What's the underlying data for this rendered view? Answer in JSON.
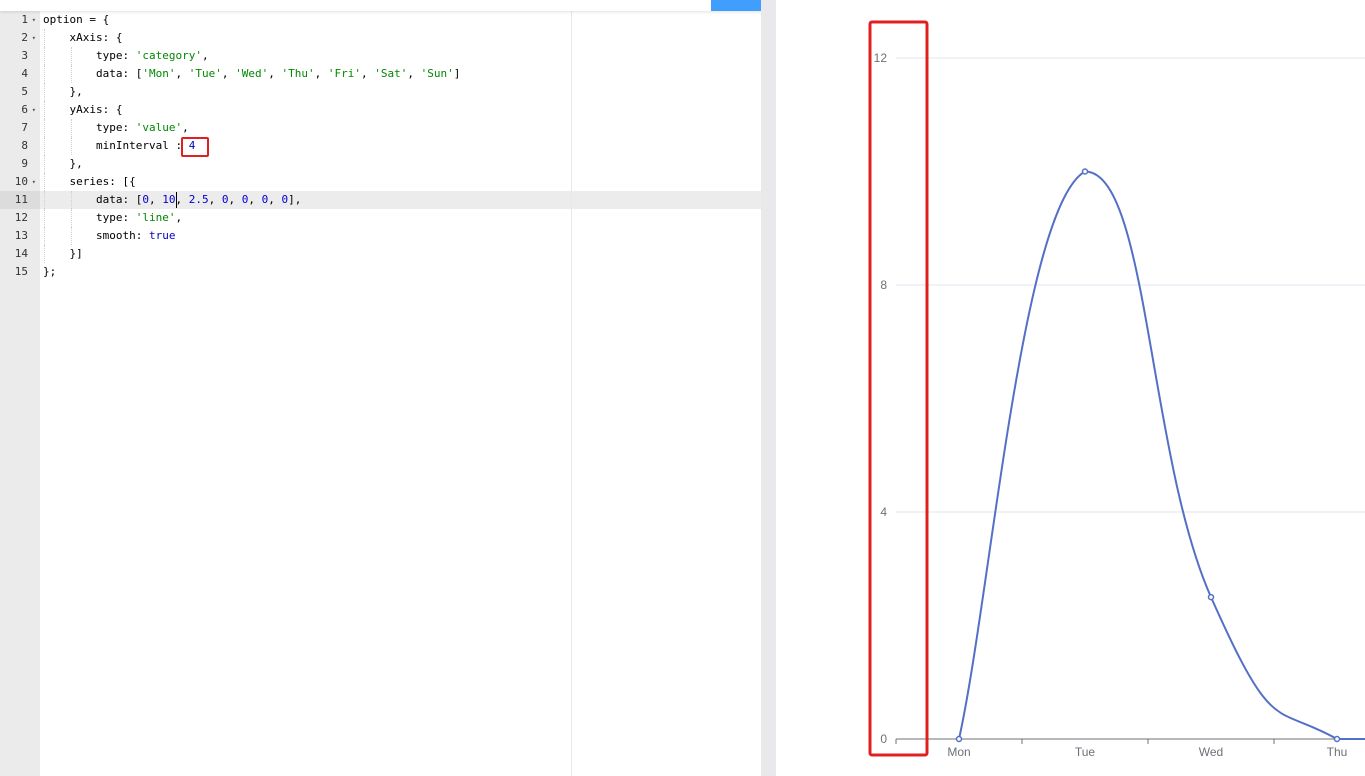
{
  "editor": {
    "lines": [
      {
        "n": "1",
        "fold": true,
        "indent": 0,
        "tokens": [
          {
            "t": "option = {"
          }
        ]
      },
      {
        "n": "2",
        "fold": true,
        "indent": 1,
        "tokens": [
          {
            "t": "xAxis: {"
          }
        ]
      },
      {
        "n": "3",
        "fold": false,
        "indent": 2,
        "tokens": [
          {
            "t": "type: "
          },
          {
            "t": "'category'",
            "c": "str"
          },
          {
            "t": ","
          }
        ]
      },
      {
        "n": "4",
        "fold": false,
        "indent": 2,
        "tokens": [
          {
            "t": "data: ["
          },
          {
            "t": "'Mon'",
            "c": "str"
          },
          {
            "t": ", "
          },
          {
            "t": "'Tue'",
            "c": "str"
          },
          {
            "t": ", "
          },
          {
            "t": "'Wed'",
            "c": "str"
          },
          {
            "t": ", "
          },
          {
            "t": "'Thu'",
            "c": "str"
          },
          {
            "t": ", "
          },
          {
            "t": "'Fri'",
            "c": "str"
          },
          {
            "t": ", "
          },
          {
            "t": "'Sat'",
            "c": "str"
          },
          {
            "t": ", "
          },
          {
            "t": "'Sun'",
            "c": "str"
          },
          {
            "t": "]"
          }
        ]
      },
      {
        "n": "5",
        "fold": false,
        "indent": 1,
        "tokens": [
          {
            "t": "},"
          }
        ]
      },
      {
        "n": "6",
        "fold": true,
        "indent": 1,
        "tokens": [
          {
            "t": "yAxis: {"
          }
        ]
      },
      {
        "n": "7",
        "fold": false,
        "indent": 2,
        "tokens": [
          {
            "t": "type: "
          },
          {
            "t": "'value'",
            "c": "str"
          },
          {
            "t": ","
          }
        ]
      },
      {
        "n": "8",
        "fold": false,
        "indent": 2,
        "tokens": [
          {
            "t": "minInterval : "
          },
          {
            "t": "4",
            "c": "num"
          }
        ]
      },
      {
        "n": "9",
        "fold": false,
        "indent": 1,
        "tokens": [
          {
            "t": "},"
          }
        ]
      },
      {
        "n": "10",
        "fold": true,
        "indent": 1,
        "tokens": [
          {
            "t": "series: [{"
          }
        ]
      },
      {
        "n": "11",
        "fold": false,
        "indent": 2,
        "active": true,
        "tokens": [
          {
            "t": "data: ["
          },
          {
            "t": "0",
            "c": "num"
          },
          {
            "t": ", "
          },
          {
            "t": "10",
            "c": "num"
          },
          {
            "t": ", "
          },
          {
            "t": "2.5",
            "c": "num"
          },
          {
            "t": ", "
          },
          {
            "t": "0",
            "c": "num"
          },
          {
            "t": ", "
          },
          {
            "t": "0",
            "c": "num"
          },
          {
            "t": ", "
          },
          {
            "t": "0",
            "c": "num"
          },
          {
            "t": ", "
          },
          {
            "t": "0",
            "c": "num"
          },
          {
            "t": "],"
          }
        ]
      },
      {
        "n": "12",
        "fold": false,
        "indent": 2,
        "tokens": [
          {
            "t": "type: "
          },
          {
            "t": "'line'",
            "c": "str"
          },
          {
            "t": ","
          }
        ]
      },
      {
        "n": "13",
        "fold": false,
        "indent": 2,
        "tokens": [
          {
            "t": "smooth: "
          },
          {
            "t": "true",
            "c": "kw"
          }
        ]
      },
      {
        "n": "14",
        "fold": false,
        "indent": 1,
        "tokens": [
          {
            "t": "}]"
          }
        ]
      },
      {
        "n": "15",
        "fold": false,
        "indent": 0,
        "tokens": [
          {
            "t": "};"
          }
        ]
      }
    ]
  },
  "colors": {
    "series": "#5470c6",
    "annotation": "#e02020",
    "axis": "#6e7079",
    "grid": "#e0e6f1"
  },
  "chart_data": {
    "type": "line",
    "smooth": true,
    "categories": [
      "Mon",
      "Tue",
      "Wed",
      "Thu",
      "Fri",
      "Sat",
      "Sun"
    ],
    "visible_categories": [
      "Mon",
      "Tue",
      "Wed",
      "Thu"
    ],
    "series": [
      {
        "values": [
          0,
          10,
          2.5,
          0,
          0,
          0,
          0
        ]
      }
    ],
    "yticks": [
      0,
      4,
      8,
      12
    ],
    "ylim": [
      0,
      12
    ],
    "grid": true,
    "annotation": "red box around y-axis labels"
  }
}
